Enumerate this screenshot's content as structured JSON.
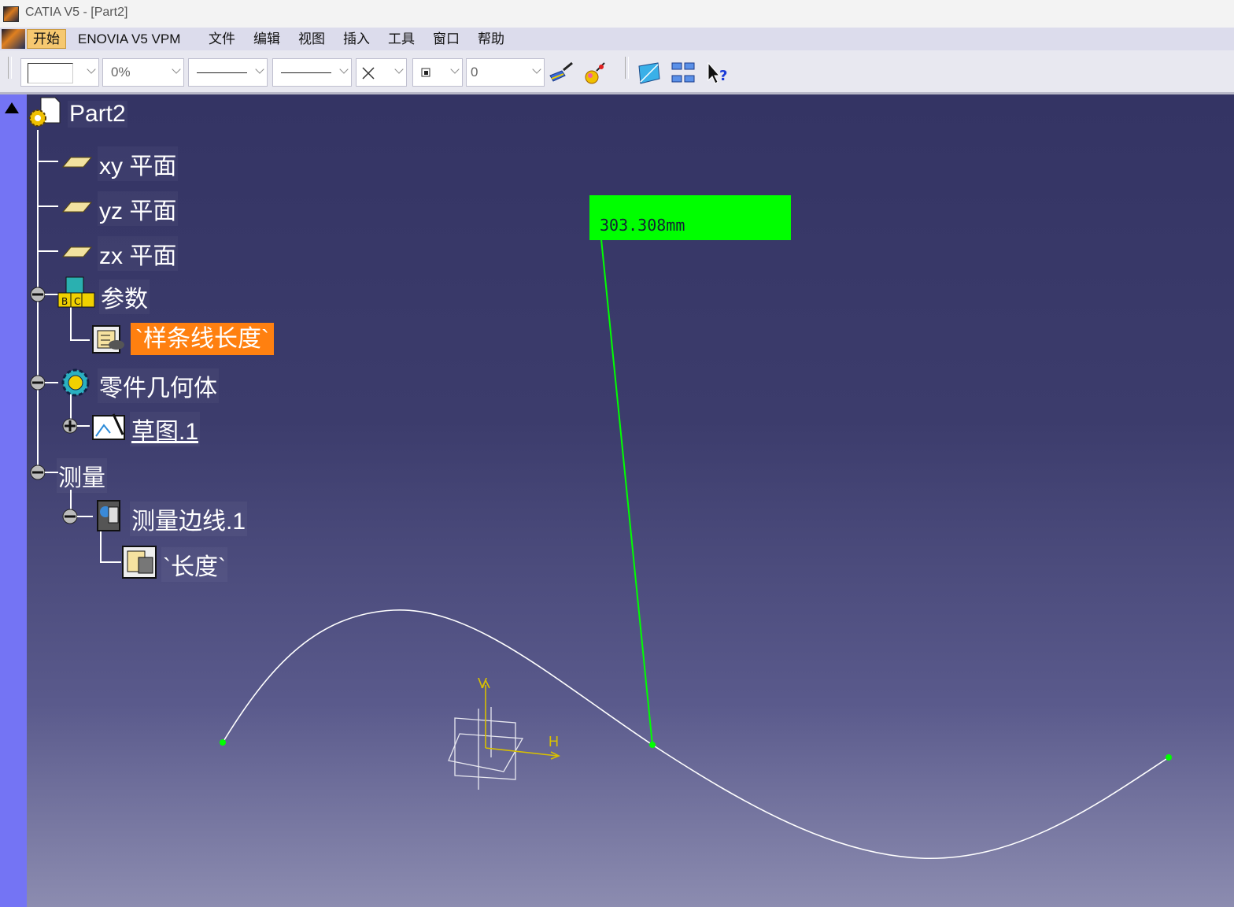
{
  "window": {
    "title": "CATIA V5 - [Part2]"
  },
  "menu": {
    "items": [
      {
        "label": "开始"
      },
      {
        "label": "ENOVIA V5 VPM"
      },
      {
        "label": "文件"
      },
      {
        "label": "编辑"
      },
      {
        "label": "视图"
      },
      {
        "label": "插入"
      },
      {
        "label": "工具"
      },
      {
        "label": "窗口"
      },
      {
        "label": "帮助"
      }
    ],
    "active": "开始"
  },
  "toolbar": {
    "transparency": "0%",
    "layer": "0",
    "icons": [
      "fill-color-swatch",
      "transparency",
      "line-thickness",
      "line-type",
      "point-symbol",
      "rendering-style",
      "layer",
      "painter-brush",
      "color-palette-ball",
      "tree-map-icon",
      "tree-structure-icon",
      "whats-this-help-icon"
    ]
  },
  "tree": {
    "root": "Part2",
    "planes": [
      "xy 平面",
      "yz 平面",
      "zx 平面"
    ],
    "parameters": {
      "label": "参数",
      "child": "`样条线长度`"
    },
    "partbody": {
      "label": "零件几何体",
      "child": "草图.1"
    },
    "measure": {
      "label": "测量",
      "child": "测量边线.1",
      "grandchild": "`长度`"
    }
  },
  "viewport": {
    "measure_value": "303.308mm",
    "axis_labels": {
      "v": "V",
      "h": "H"
    },
    "colors": {
      "measure": "#00ff00",
      "selection": "#ff8010",
      "axis": "#d8c000",
      "curve": "#ffffff"
    }
  }
}
